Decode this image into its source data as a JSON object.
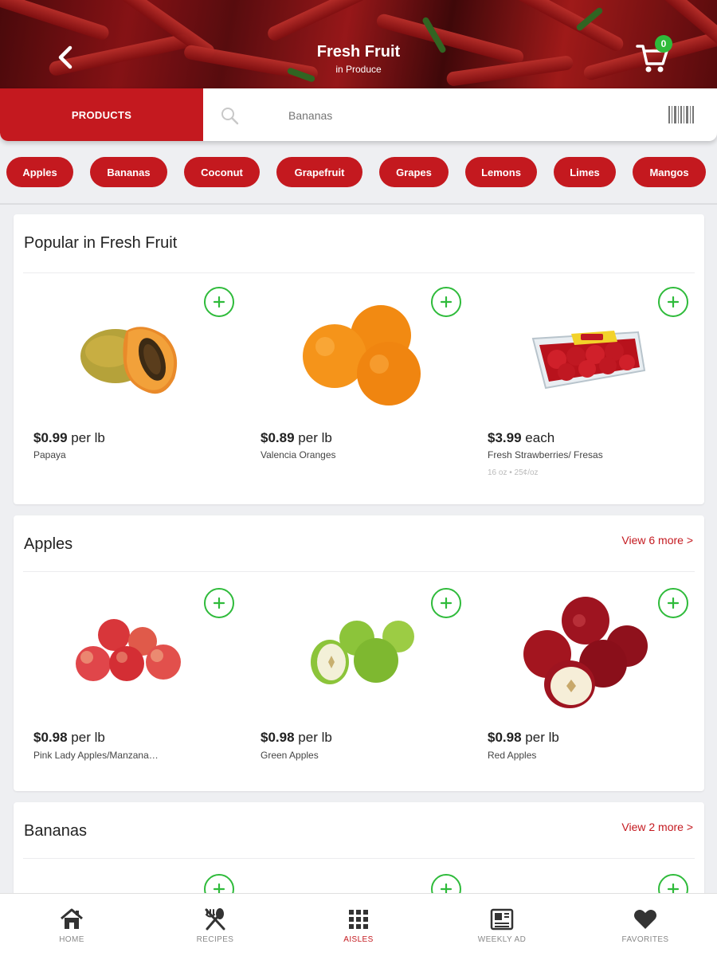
{
  "header": {
    "title": "Fresh Fruit",
    "subtitle": "in Produce",
    "cart_count": "0"
  },
  "search": {
    "tab_label": "PRODUCTS",
    "placeholder": "Bananas"
  },
  "chips": [
    "Apples",
    "Bananas",
    "Coconut",
    "Grapefruit",
    "Grapes",
    "Lemons",
    "Limes",
    "Mangos"
  ],
  "sections": [
    {
      "title": "Popular in Fresh Fruit",
      "view_more": "",
      "items": [
        {
          "price": "$0.99",
          "unit": "per lb",
          "name": "Papaya",
          "note": "",
          "image": "papaya"
        },
        {
          "price": "$0.89",
          "unit": "per lb",
          "name": "Valencia Oranges",
          "note": "",
          "image": "oranges"
        },
        {
          "price": "$3.99",
          "unit": "each",
          "name": "Fresh Strawberries/ Fresas",
          "note": "16 oz • 25¢/oz",
          "image": "strawberries"
        }
      ]
    },
    {
      "title": "Apples",
      "view_more": "View 6 more >",
      "items": [
        {
          "price": "$0.98",
          "unit": "per lb",
          "name": "Pink Lady Apples/Manzana…",
          "note": "",
          "image": "pink-apples"
        },
        {
          "price": "$0.98",
          "unit": "per lb",
          "name": "Green Apples",
          "note": "",
          "image": "green-apples"
        },
        {
          "price": "$0.98",
          "unit": "per lb",
          "name": "Red Apples",
          "note": "",
          "image": "red-apples"
        }
      ]
    },
    {
      "title": "Bananas",
      "view_more": "View 2 more >",
      "items": []
    }
  ],
  "nav": [
    {
      "label": "HOME",
      "icon": "home-icon",
      "active": false
    },
    {
      "label": "RECIPES",
      "icon": "recipes-icon",
      "active": false
    },
    {
      "label": "AISLES",
      "icon": "aisles-icon",
      "active": true
    },
    {
      "label": "WEEKLY AD",
      "icon": "weekly-ad-icon",
      "active": false
    },
    {
      "label": "FAVORITES",
      "icon": "heart-icon",
      "active": false
    }
  ],
  "colors": {
    "brand_red": "#c4191f",
    "add_green": "#2fbb3b"
  }
}
